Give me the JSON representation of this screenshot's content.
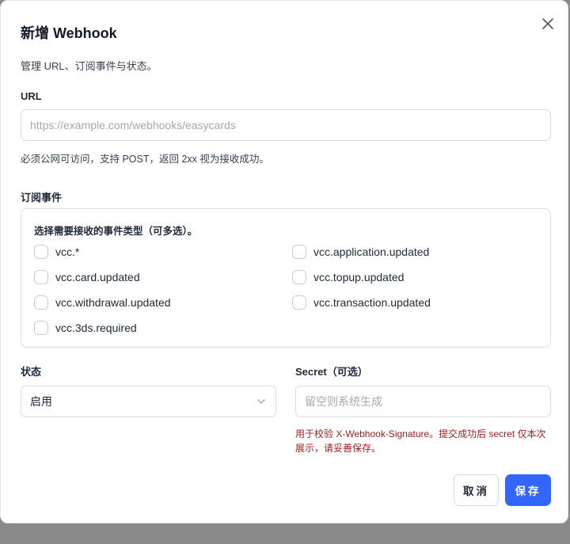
{
  "dialog": {
    "title": "新增 Webhook",
    "subtitle": "管理 URL、订阅事件与状态。",
    "close_icon": "close-icon"
  },
  "url": {
    "label": "URL",
    "value": "",
    "placeholder": "https://example.com/webhooks/easycards",
    "hint": "必须公网可访问，支持 POST，返回 2xx 视为接收成功。"
  },
  "events": {
    "label": "订阅事件",
    "description": "选择需要接收的事件类型（可多选）。",
    "items": [
      {
        "label": "vcc.*",
        "checked": false
      },
      {
        "label": "vcc.application.updated",
        "checked": false
      },
      {
        "label": "vcc.card.updated",
        "checked": false
      },
      {
        "label": "vcc.topup.updated",
        "checked": false
      },
      {
        "label": "vcc.withdrawal.updated",
        "checked": false
      },
      {
        "label": "vcc.transaction.updated",
        "checked": false
      },
      {
        "label": "vcc.3ds.required",
        "checked": false
      }
    ]
  },
  "status": {
    "label": "状态",
    "selected": "启用"
  },
  "secret": {
    "label": "Secret（可选）",
    "value": "",
    "placeholder": "留空则系统生成",
    "warning": "用于校验 X-Webhook-Signature。提交成功后 secret 仅本次展示，请妥善保存。"
  },
  "actions": {
    "cancel_label": "取消",
    "save_label": "保存"
  },
  "colors": {
    "primary": "#3366ff",
    "warning_text": "#9b1c1c",
    "border": "#d9dce1"
  }
}
